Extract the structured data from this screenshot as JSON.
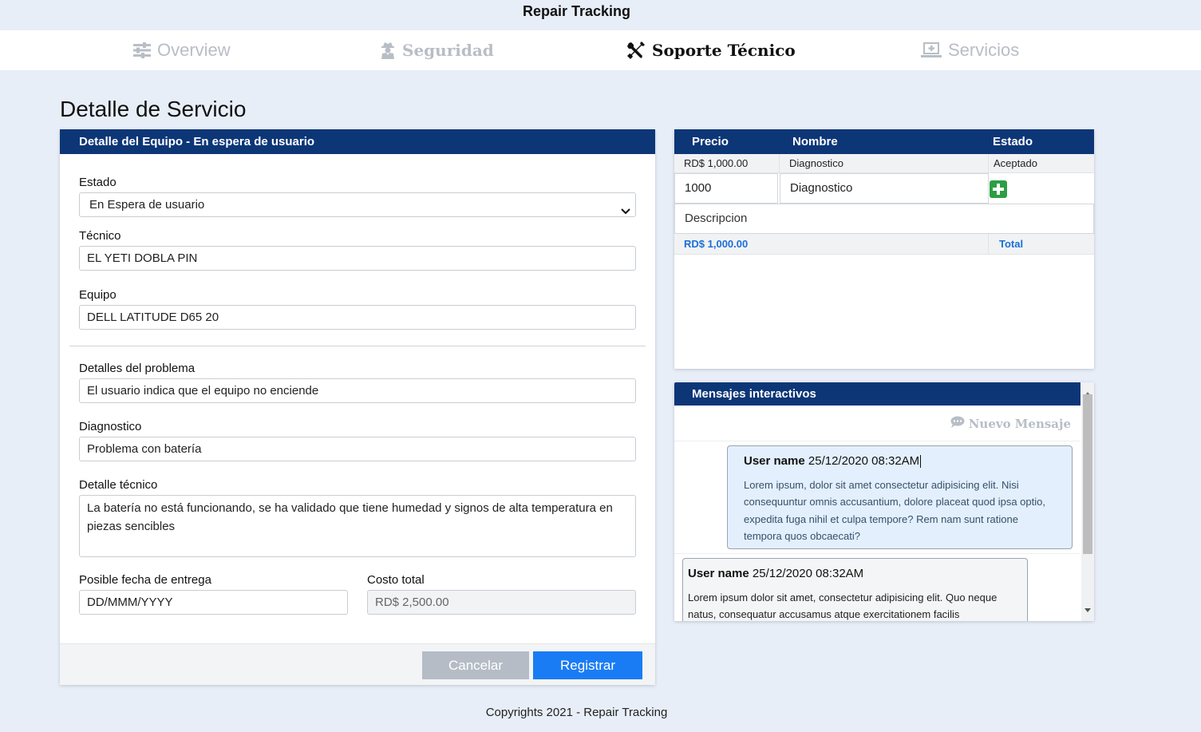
{
  "app": {
    "title": "Repair Tracking"
  },
  "nav": {
    "tabs": [
      {
        "label": "Overview",
        "icon": "sliders-icon"
      },
      {
        "label": "Seguridad",
        "icon": "user-secret-icon"
      },
      {
        "label": "Soporte Técnico",
        "icon": "tools-icon",
        "active": true
      },
      {
        "label": "Servicios",
        "icon": "laptop-plus-icon"
      }
    ]
  },
  "page": {
    "title": "Detalle de Servicio"
  },
  "equipment_form": {
    "header": "Detalle del Equipo - En espera de usuario",
    "estado_label": "Estado",
    "estado_value": "En Espera de usuario",
    "tecnico_label": "Técnico",
    "tecnico_value": "EL YETI DOBLA PIN",
    "equipo_label": "Equipo",
    "equipo_value": "DELL LATITUDE D65 20",
    "problema_label": "Detalles del problema",
    "problema_value": "El usuario indica que el equipo no enciende",
    "diagnostico_label": "Diagnostico",
    "diagnostico_value": "Problema con batería",
    "detalle_tecnico_label": "Detalle técnico",
    "detalle_tecnico_value": "La batería no está funcionando, se ha validado que tiene humedad y signos de alta temperatura en piezas sencibles",
    "fecha_label": "Posible fecha de entrega",
    "fecha_placeholder": "DD/MMM/YYYY",
    "costo_label": "Costo total",
    "costo_value": "RD$ 2,500.00",
    "cancel_label": "Cancelar",
    "submit_label": "Registrar"
  },
  "charges_table": {
    "headers": {
      "precio": "Precio",
      "nombre": "Nombre",
      "estado": "Estado"
    },
    "rows": [
      {
        "precio": "RD$ 1,000.00",
        "nombre": "Diagnostico",
        "estado": "Aceptado"
      }
    ],
    "new_row": {
      "precio": "1000",
      "nombre": "Diagnostico",
      "descripcion_placeholder": "Descripcion"
    },
    "total_amount": "RD$ 1,000.00",
    "total_label": "Total",
    "accent_color": "#1a6fd8",
    "add_icon_color": "#2e9e44"
  },
  "messages": {
    "header": "Mensajes interactivos",
    "new_message_label": "Nuevo Mensaje",
    "items": [
      {
        "user": "User name",
        "timestamp": "25/12/2020 08:32AM",
        "body": "Lorem ipsum, dolor sit amet consectetur adipisicing elit. Nisi consequuntur omnis accusantium, dolore placeat quod ipsa optio, expedita fuga nihil et culpa tempore? Rem nam sunt ratione tempora quos obcaecati?"
      },
      {
        "user": "User name",
        "timestamp": "25/12/2020 08:32AM",
        "body": "Lorem ipsum dolor sit amet, consectetur adipisicing elit. Quo neque natus, consequatur accusamus atque exercitationem facilis"
      }
    ]
  },
  "footer": {
    "copyright": "Copyrights 2021 - Repair Tracking"
  },
  "colors": {
    "brand_navy": "#0d3677",
    "primary_button": "#1a7cf4",
    "secondary_button": "#b5bcc6",
    "background": "#e8eef8"
  }
}
